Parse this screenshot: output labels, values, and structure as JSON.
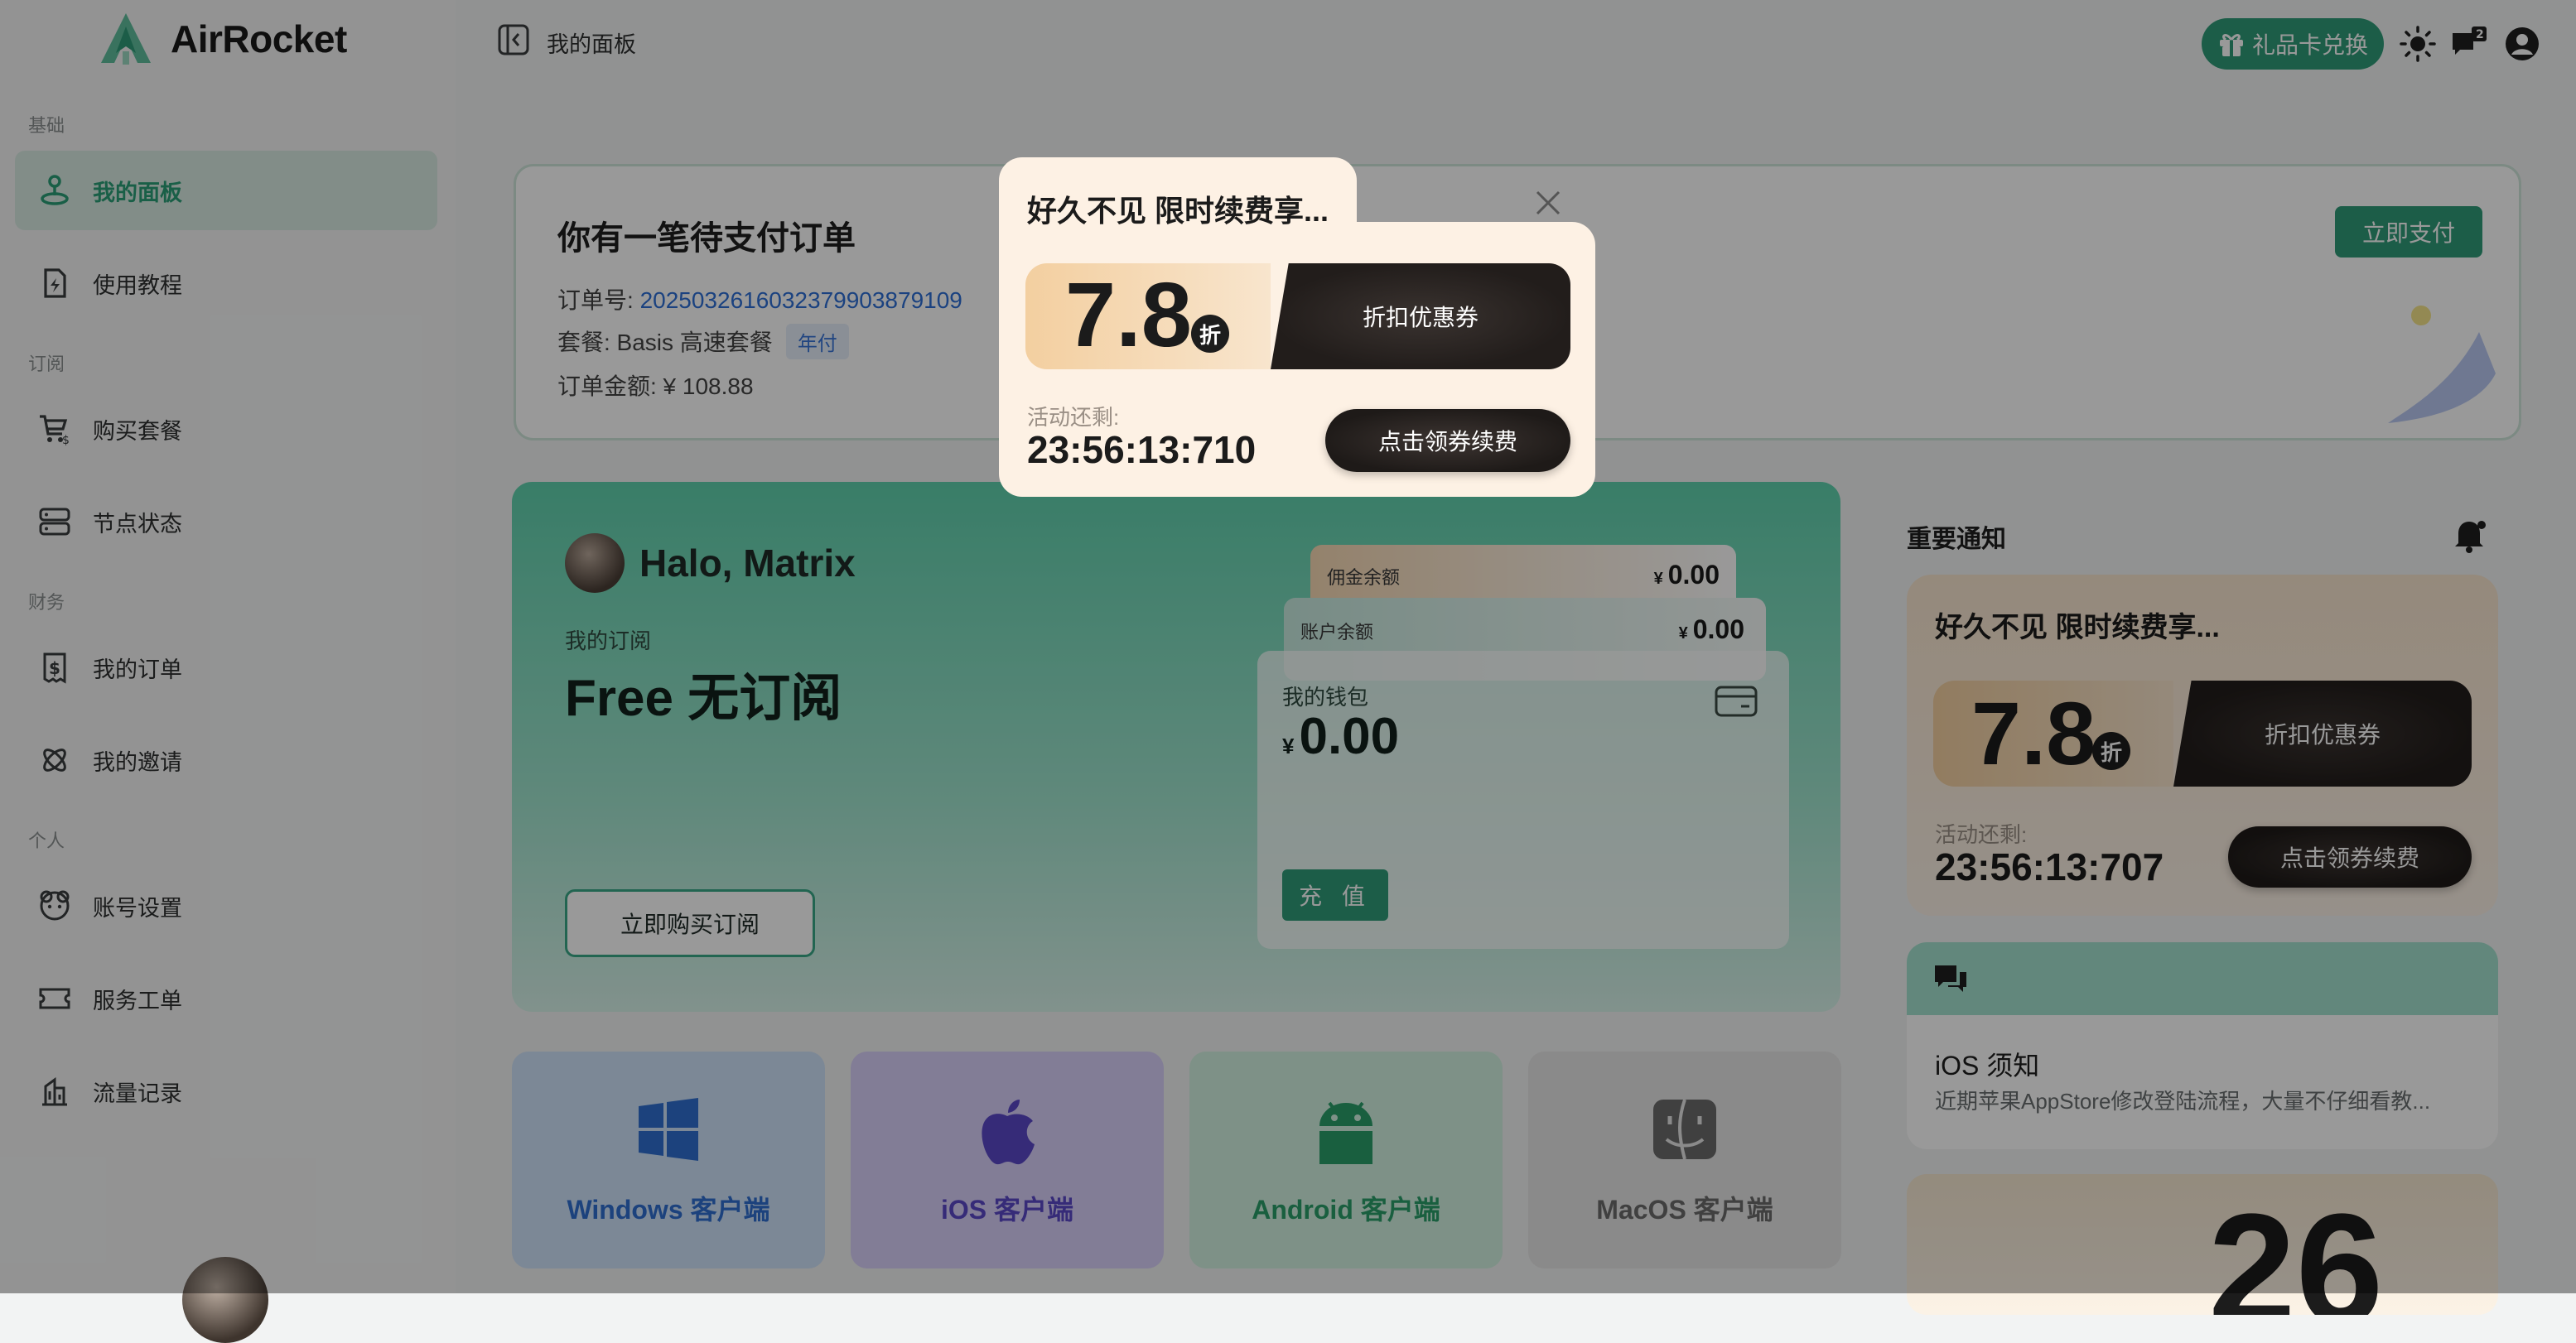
{
  "app": {
    "name": "AirRocket"
  },
  "header": {
    "title": "我的面板",
    "gift_label": "礼品卡兑换",
    "notification_count": "2"
  },
  "sidebar": {
    "sections": [
      {
        "title": "基础",
        "items": [
          {
            "label": "我的面板",
            "icon": "joystick-icon",
            "active": true
          },
          {
            "label": "使用教程",
            "icon": "document-bolt-icon"
          }
        ]
      },
      {
        "title": "订阅",
        "items": [
          {
            "label": "购买套餐",
            "icon": "cart-icon"
          },
          {
            "label": "节点状态",
            "icon": "server-icon"
          }
        ]
      },
      {
        "title": "财务",
        "items": [
          {
            "label": "我的订单",
            "icon": "receipt-dollar-icon"
          },
          {
            "label": "我的邀请",
            "icon": "atom-icon"
          }
        ]
      },
      {
        "title": "个人",
        "items": [
          {
            "label": "账号设置",
            "icon": "user-settings-icon"
          },
          {
            "label": "服务工单",
            "icon": "ticket-icon"
          },
          {
            "label": "流量记录",
            "icon": "building-chart-icon"
          }
        ]
      }
    ]
  },
  "order": {
    "title": "你有一笔待支付订单",
    "number_label": "订单号: ",
    "number": "2025032616032379903879109",
    "plan_label": "套餐: Basis 高速套餐",
    "plan_tag": "年付",
    "amount_label": "订单金额: ¥ 108.88",
    "pay_button": "立即支付"
  },
  "dashboard": {
    "greeting": "Halo, Matrix",
    "subscription_label": "我的订阅",
    "subscription_value": "Free 无订阅",
    "buy_button": "立即购买订阅",
    "commission_label": "佣金余额",
    "commission_value": "0.00",
    "account_label": "账户余额",
    "account_value": "0.00",
    "currency": "¥",
    "wallet_label": "我的钱包",
    "wallet_value": "0.00",
    "recharge_button": "充 值"
  },
  "clients": [
    {
      "label": "Windows 客户端",
      "icon": "windows-icon",
      "bg": "#cfe3fb",
      "color": "#2f6fd0"
    },
    {
      "label": "iOS 客户端",
      "icon": "apple-icon",
      "bg": "#d9d1fb",
      "color": "#5b49c9"
    },
    {
      "label": "Android 客户端",
      "icon": "android-icon",
      "bg": "#d2f2e2",
      "color": "#2a9e6a"
    },
    {
      "label": "MacOS 客户端",
      "icon": "finder-icon",
      "bg": "#e6e6e6",
      "color": "#6b6b6b"
    }
  ],
  "notices": {
    "title": "重要通知",
    "ios_title": "iOS 须知",
    "ios_desc": "近期苹果AppStore修改登陆流程，大量不仔细看教...",
    "calendar_number": "26"
  },
  "promo_card": {
    "title": "好久不见 限时续费享...",
    "discount": "7.8",
    "discount_unit": "折",
    "coupon_label": "折扣优惠券",
    "remain_label": "活动还剩:",
    "timer": "23:56:13:707",
    "claim_button": "点击领券续费"
  },
  "modal": {
    "title": "好久不见 限时续费享...",
    "discount": "7.8",
    "discount_unit": "折",
    "coupon_label": "折扣优惠券",
    "remain_label": "活动还剩:",
    "timer": "23:56:13:710",
    "claim_button": "点击领券续费"
  },
  "colors": {
    "accent": "#2f9c78",
    "link": "#2d6fd6"
  }
}
